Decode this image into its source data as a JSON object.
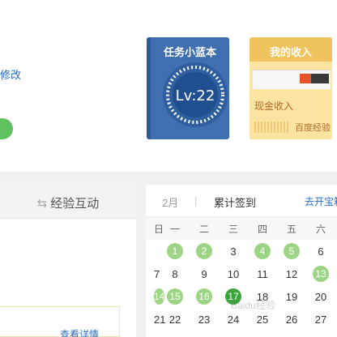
{
  "top": {
    "edit_link": "修改"
  },
  "task_card": {
    "title": "任务小蓝本",
    "level": "Lv:22",
    "color": "#3f6fae"
  },
  "income_card": {
    "title": "我的收入",
    "cash_label": "现金收入",
    "exp_label": "百度经验",
    "color": "#f0c45c"
  },
  "left_tab": {
    "icon": "swap-icon",
    "label": "经验互动"
  },
  "detail": {
    "link": "查看详情"
  },
  "calendar": {
    "month": "2月",
    "separator": "|",
    "total_label": "累计签到",
    "link": "去开宝箱",
    "weekdays": [
      "日",
      "一",
      "二",
      "三",
      "四",
      "五",
      "六"
    ],
    "rows": [
      [
        {
          "d": "",
          "s": false
        },
        {
          "d": "1",
          "s": true
        },
        {
          "d": "2",
          "s": true
        },
        {
          "d": "3",
          "s": false
        },
        {
          "d": "4",
          "s": true
        },
        {
          "d": "5",
          "s": true
        },
        {
          "d": "6",
          "s": false
        }
      ],
      [
        {
          "d": "7",
          "s": false
        },
        {
          "d": "8",
          "s": false
        },
        {
          "d": "9",
          "s": false
        },
        {
          "d": "10",
          "s": false
        },
        {
          "d": "11",
          "s": false
        },
        {
          "d": "12",
          "s": false
        },
        {
          "d": "13",
          "s": true
        }
      ],
      [
        {
          "d": "14",
          "s": true
        },
        {
          "d": "15",
          "s": true
        },
        {
          "d": "16",
          "s": true
        },
        {
          "d": "17",
          "s": true,
          "today": true
        },
        {
          "d": "18",
          "s": false
        },
        {
          "d": "19",
          "s": false
        },
        {
          "d": "20",
          "s": false
        }
      ],
      [
        {
          "d": "21",
          "s": false
        },
        {
          "d": "22",
          "s": false
        },
        {
          "d": "23",
          "s": false
        },
        {
          "d": "24",
          "s": false
        },
        {
          "d": "25",
          "s": false
        },
        {
          "d": "26",
          "s": false
        },
        {
          "d": "27",
          "s": false
        }
      ]
    ],
    "signed_color": "#9ed486",
    "today_color": "#3ba53b"
  },
  "watermark": "Baidu经验"
}
